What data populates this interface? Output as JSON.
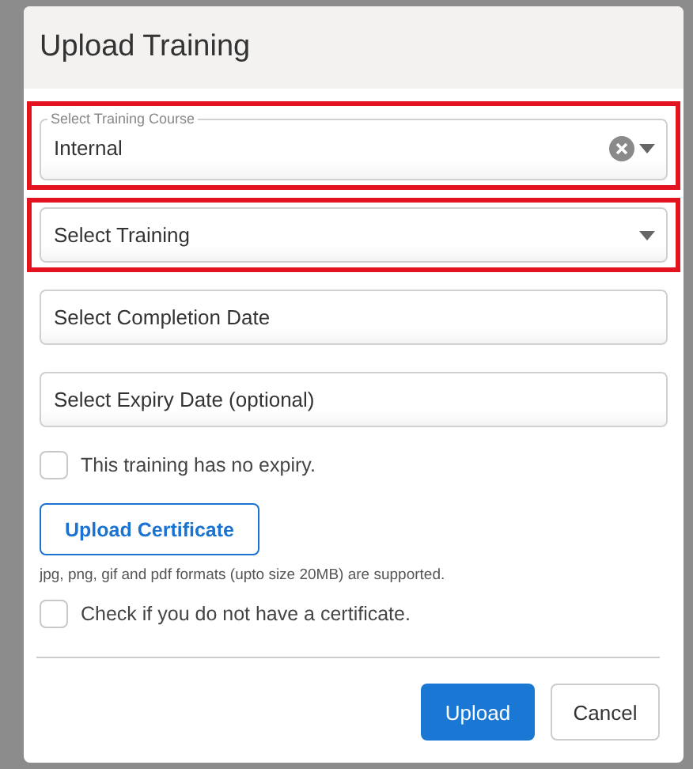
{
  "dialog": {
    "title": "Upload Training"
  },
  "fields": [
    {
      "kind": "select",
      "label": "Select Training Course",
      "value": "Internal",
      "clearable": true,
      "highlighted": true
    },
    {
      "kind": "select",
      "placeholder": "Select Training",
      "clearable": false,
      "highlighted": true
    },
    {
      "kind": "date",
      "placeholder": "Select Completion Date",
      "highlighted": false
    },
    {
      "kind": "date",
      "placeholder": "Select Expiry Date (optional)",
      "highlighted": false
    }
  ],
  "no_expiry": {
    "label": "This training has no expiry.",
    "checked": false
  },
  "upload_certificate": {
    "label": "Upload Certificate",
    "hint": "jpg, png, gif and pdf formats (upto size 20MB) are supported."
  },
  "no_certificate": {
    "label": "Check if you do not have a certificate.",
    "checked": false
  },
  "buttons": [
    {
      "kind": "primary",
      "label": "Upload"
    },
    {
      "kind": "secondary",
      "label": "Cancel"
    }
  ]
}
